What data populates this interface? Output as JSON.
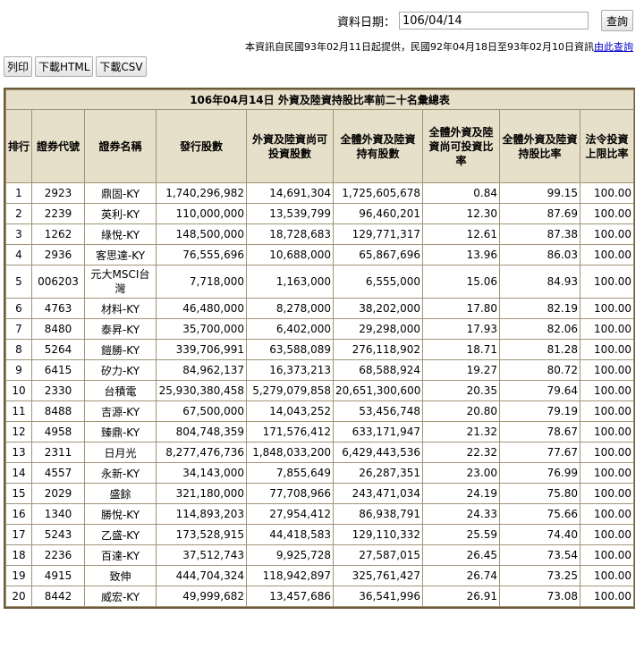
{
  "header": {
    "date_label": "資料日期：",
    "date_value": "106/04/14",
    "query_label": "查詢",
    "notice_text": "本資訊自民國93年02月11日起提供，民國92年04月18日至93年02月10日資訊",
    "notice_link": "由此查詢"
  },
  "toolbar": {
    "print_label": "列印",
    "html_label": "下載HTML",
    "csv_label": "下載CSV"
  },
  "table": {
    "caption": "106年04月14日 外資及陸資持股比率前二十名彙總表",
    "headers": [
      "排行",
      "證券代號",
      "證券名稱",
      "發行股數",
      "外資及陸資尚可投資股數",
      "全體外資及陸資持有股數",
      "全體外資及陸資尚可投資比率",
      "全體外資及陸資持股比率",
      "法令投資上限比率"
    ],
    "rows": [
      [
        "1",
        "2923",
        "鼎固-KY",
        "1,740,296,982",
        "14,691,304",
        "1,725,605,678",
        "0.84",
        "99.15",
        "100.00"
      ],
      [
        "2",
        "2239",
        "英利-KY",
        "110,000,000",
        "13,539,799",
        "96,460,201",
        "12.30",
        "87.69",
        "100.00"
      ],
      [
        "3",
        "1262",
        "綠悅-KY",
        "148,500,000",
        "18,728,683",
        "129,771,317",
        "12.61",
        "87.38",
        "100.00"
      ],
      [
        "4",
        "2936",
        "客思達-KY",
        "76,555,696",
        "10,688,000",
        "65,867,696",
        "13.96",
        "86.03",
        "100.00"
      ],
      [
        "5",
        "006203",
        "元大MSCI台灣",
        "7,718,000",
        "1,163,000",
        "6,555,000",
        "15.06",
        "84.93",
        "100.00"
      ],
      [
        "6",
        "4763",
        "材料-KY",
        "46,480,000",
        "8,278,000",
        "38,202,000",
        "17.80",
        "82.19",
        "100.00"
      ],
      [
        "7",
        "8480",
        "泰昇-KY",
        "35,700,000",
        "6,402,000",
        "29,298,000",
        "17.93",
        "82.06",
        "100.00"
      ],
      [
        "8",
        "5264",
        "鎧勝-KY",
        "339,706,991",
        "63,588,089",
        "276,118,902",
        "18.71",
        "81.28",
        "100.00"
      ],
      [
        "9",
        "6415",
        "矽力-KY",
        "84,962,137",
        "16,373,213",
        "68,588,924",
        "19.27",
        "80.72",
        "100.00"
      ],
      [
        "10",
        "2330",
        "台積電",
        "25,930,380,458",
        "5,279,079,858",
        "20,651,300,600",
        "20.35",
        "79.64",
        "100.00"
      ],
      [
        "11",
        "8488",
        "吉源-KY",
        "67,500,000",
        "14,043,252",
        "53,456,748",
        "20.80",
        "79.19",
        "100.00"
      ],
      [
        "12",
        "4958",
        "臻鼎-KY",
        "804,748,359",
        "171,576,412",
        "633,171,947",
        "21.32",
        "78.67",
        "100.00"
      ],
      [
        "13",
        "2311",
        "日月光",
        "8,277,476,736",
        "1,848,033,200",
        "6,429,443,536",
        "22.32",
        "77.67",
        "100.00"
      ],
      [
        "14",
        "4557",
        "永新-KY",
        "34,143,000",
        "7,855,649",
        "26,287,351",
        "23.00",
        "76.99",
        "100.00"
      ],
      [
        "15",
        "2029",
        "盛餘",
        "321,180,000",
        "77,708,966",
        "243,471,034",
        "24.19",
        "75.80",
        "100.00"
      ],
      [
        "16",
        "1340",
        "勝悅-KY",
        "114,893,203",
        "27,954,412",
        "86,938,791",
        "24.33",
        "75.66",
        "100.00"
      ],
      [
        "17",
        "5243",
        "乙盛-KY",
        "173,528,915",
        "44,418,583",
        "129,110,332",
        "25.59",
        "74.40",
        "100.00"
      ],
      [
        "18",
        "2236",
        "百達-KY",
        "37,512,743",
        "9,925,728",
        "27,587,015",
        "26.45",
        "73.54",
        "100.00"
      ],
      [
        "19",
        "4915",
        "致伸",
        "444,704,324",
        "118,942,897",
        "325,761,427",
        "26.74",
        "73.25",
        "100.00"
      ],
      [
        "20",
        "8442",
        "威宏-KY",
        "49,999,682",
        "13,457,686",
        "36,541,996",
        "26.91",
        "73.08",
        "100.00"
      ]
    ]
  }
}
